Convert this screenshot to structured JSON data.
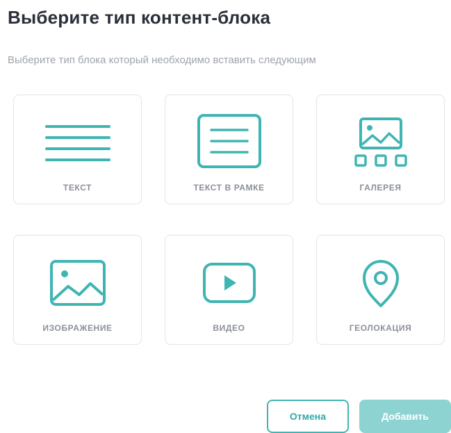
{
  "dialog": {
    "title": "Выберите тип контент-блока",
    "subtitle": "Выберите тип блока который необходимо вставить следующим"
  },
  "block_types": [
    {
      "label": "ТЕКСТ",
      "icon": "text-lines-icon"
    },
    {
      "label": "ТЕКСТ В РАМКЕ",
      "icon": "framed-text-icon"
    },
    {
      "label": "ГАЛЕРЕЯ",
      "icon": "gallery-icon"
    },
    {
      "label": "ИЗОБРАЖЕНИЕ",
      "icon": "image-icon"
    },
    {
      "label": "ВИДЕО",
      "icon": "video-play-icon"
    },
    {
      "label": "ГЕОЛОКАЦИЯ",
      "icon": "location-pin-icon"
    }
  ],
  "buttons": {
    "cancel": "Отмена",
    "add": "Добавить"
  },
  "colors": {
    "accent": "#3fb5b3",
    "accent_disabled": "#8dd3d1",
    "title": "#2b2f3a",
    "muted": "#9ea3ad"
  }
}
